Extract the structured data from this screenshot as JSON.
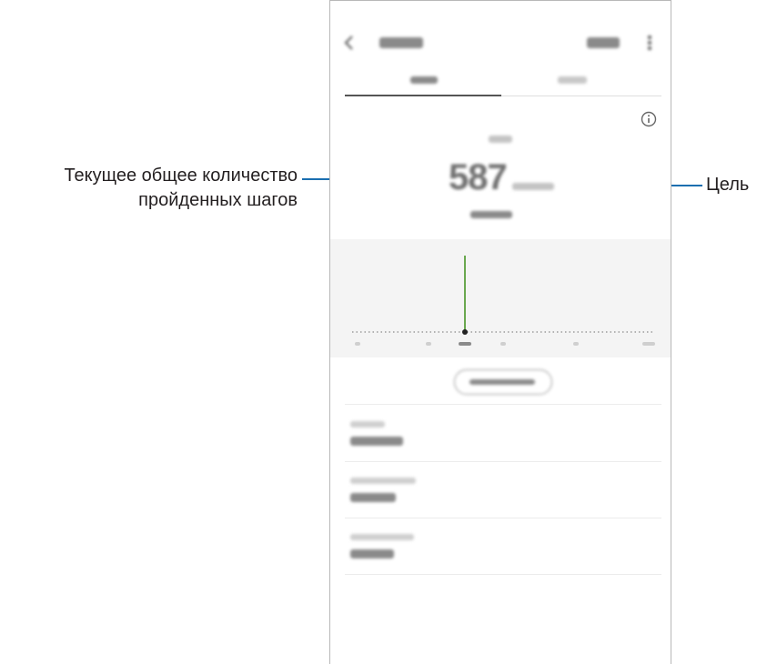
{
  "callouts": {
    "current_steps": "Текущее общее количество пройденных шагов",
    "goal": "Цель"
  },
  "header": {
    "back_icon": "chevron-left-icon",
    "title": "",
    "action": "",
    "more_icon": "more-vertical-icon"
  },
  "tabs": [
    {
      "label": "",
      "active": true
    },
    {
      "label": ""
    }
  ],
  "summary": {
    "info_icon": "info-icon",
    "period": "",
    "steps": "587",
    "goal": "",
    "subtitle": ""
  },
  "chart_data": {
    "type": "bar",
    "categories": [
      "",
      "",
      "",
      "",
      "",
      ""
    ],
    "values": [
      0,
      0,
      587,
      0,
      0,
      0
    ],
    "title": "",
    "xlabel": "",
    "ylabel": ""
  },
  "pill_button": {
    "label": ""
  },
  "stats": [
    {
      "label": "",
      "value": ""
    },
    {
      "label": "",
      "value": ""
    },
    {
      "label": "",
      "value": ""
    }
  ],
  "colors": {
    "leader": "#1a6fb0",
    "bar": "#6aa84f",
    "tab_indicator": "#555555",
    "chart_bg": "#f4f4f4",
    "placeholder_dark": "#8a8a8a",
    "placeholder_light": "#d4d4d4"
  }
}
